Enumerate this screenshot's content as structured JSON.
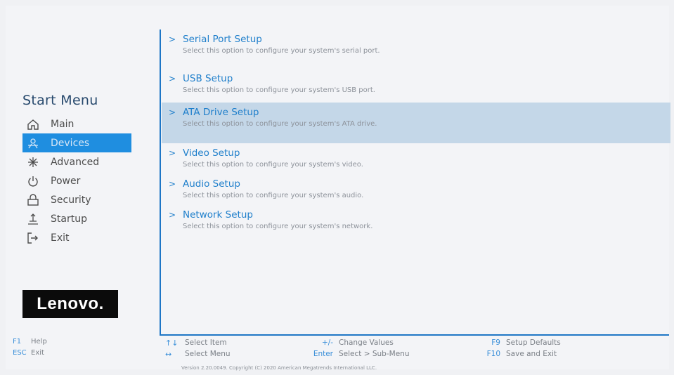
{
  "sidebar": {
    "title": "Start Menu",
    "items": [
      {
        "label": "Main",
        "icon": "home-icon",
        "active": false
      },
      {
        "label": "Devices",
        "icon": "devices-icon",
        "active": true
      },
      {
        "label": "Advanced",
        "icon": "advanced-icon",
        "active": false
      },
      {
        "label": "Power",
        "icon": "power-icon",
        "active": false
      },
      {
        "label": "Security",
        "icon": "lock-icon",
        "active": false
      },
      {
        "label": "Startup",
        "icon": "startup-icon",
        "active": false
      },
      {
        "label": "Exit",
        "icon": "exit-icon",
        "active": false
      }
    ],
    "logo": "Lenovo."
  },
  "entries": [
    {
      "title": "Serial Port Setup",
      "desc": "Select this option to configure your system's serial port."
    },
    {
      "title": "USB Setup",
      "desc": "Select this option to configure your system's USB port."
    },
    {
      "title": "ATA Drive Setup",
      "desc": "Select this option to configure your system's ATA drive.",
      "selected": true
    },
    {
      "title": "Video Setup",
      "desc": "Select this option to configure your system's video."
    },
    {
      "title": "Audio Setup",
      "desc": "Select this option to configure your system's audio."
    },
    {
      "title": "Network Setup",
      "desc": "Select this option to configure your system's network."
    }
  ],
  "footer": {
    "left": [
      {
        "key": "F1",
        "label": "Help"
      },
      {
        "key": "ESC",
        "label": "Exit"
      }
    ],
    "col1": [
      {
        "key": "↑↓",
        "label": "Select Item"
      },
      {
        "key": "↔",
        "label": "Select Menu"
      }
    ],
    "col2": [
      {
        "key": "+/-",
        "label": "Change Values"
      },
      {
        "key": "Enter",
        "label": "Select > Sub-Menu"
      }
    ],
    "col3": [
      {
        "key": "F9",
        "label": "Setup Defaults"
      },
      {
        "key": "F10",
        "label": "Save and Exit"
      }
    ],
    "copyright": "Version 2.20.0049. Copyright (C) 2020 American Megatrends International LLC."
  },
  "colors": {
    "accent": "#1f8ee0",
    "title": "#1f7fcb",
    "selected_bg": "#c4d7e8"
  }
}
